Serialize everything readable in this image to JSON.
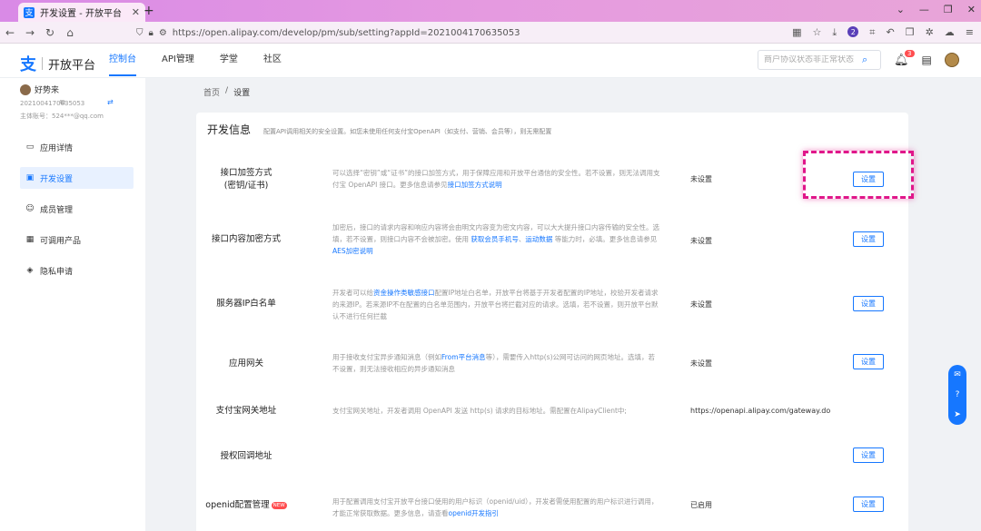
{
  "browser": {
    "tab_title": "开发设置 - 开放平台",
    "tab_favicon": "支",
    "url": "https://open.alipay.com/develop/pm/sub/setting?appId=2021004170635053",
    "ext_badge": "2"
  },
  "header": {
    "logo_mark": "支",
    "logo_text": "开放平台",
    "nav": [
      "控制台",
      "API管理",
      "学堂",
      "社区"
    ],
    "search_placeholder": "商户协议状态非正常状态",
    "bell_count": "3"
  },
  "user": {
    "name": "好势来",
    "app_id": "2021004170635053",
    "account": "主体账号：524***@qq.com"
  },
  "sidebar": {
    "items": [
      {
        "label": "应用详情",
        "icon": "doc-icon"
      },
      {
        "label": "开发设置",
        "icon": "code-icon"
      },
      {
        "label": "成员管理",
        "icon": "users-icon"
      },
      {
        "label": "可调用产品",
        "icon": "product-icon"
      },
      {
        "label": "隐私申请",
        "icon": "shield-icon"
      }
    ]
  },
  "breadcrumb": {
    "home": "首页",
    "sep": "/",
    "current": "设置"
  },
  "card": {
    "title": "开发信息",
    "desc": "配置API调用相关的安全设置。如您未使用任何支付宝OpenAPI（如支付、营销、会员等），则无需配置"
  },
  "rows": [
    {
      "label1": "接口加签方式",
      "label2": "(密钥/证书)",
      "desc_a": "可以选择“密钥”或“证书”的接口加签方式，用于保障应用和开放平台通信的安全性。若不设置，则无法调用支付宝 OpenAPI 接口。更多信息请参见",
      "link_a": "接口加签方式说明",
      "status": "未设置",
      "button": "设置"
    },
    {
      "label1": "接口内容加密方式",
      "desc_a": "加密后，接口的请求内容和响应内容将会由明文内容变为密文内容，可以大大提升接口内容传输的安全性。选填，若不设置，则接口内容不会被加密。使用 ",
      "link_a": "获取会员手机号",
      "desc_b": "、",
      "link_b": "运动数据",
      "desc_c": " 等能力时，必填。更多信息请参见",
      "link_c": "AES加密说明",
      "status": "未设置",
      "button": "设置"
    },
    {
      "label1": "服务器IP白名单",
      "desc_a": "开发者可以给",
      "link_a": "资金操作类敏感接口",
      "desc_b": "配置IP地址白名单，开放平台将基于开发者配置的IP地址，校验开发者请求的来源IP。若来源IP不在配置的白名单范围内，开放平台将拦截对应的请求。选填，若不设置，则开放平台默认不进行任何拦截",
      "status": "未设置",
      "button": "设置"
    },
    {
      "label1": "应用网关",
      "desc_a": "用于接收支付宝异步通知消息（例如",
      "link_a": "From平台消息",
      "desc_b": "等），需要传入http(s)公网可访问的网页地址。选填，若不设置，则无法接收相应的异步通知消息",
      "status": "未设置",
      "button": "设置"
    },
    {
      "label1": "支付宝网关地址",
      "desc_a": "支付宝网关地址，开发者调用 OpenAPI 发送 http(s) 请求的目标地址。需配置在AlipayClient中;",
      "status": "https://openapi.alipay.com/gateway.do"
    },
    {
      "label1": "授权回调地址",
      "button": "设置"
    },
    {
      "label1": "openid配置管理",
      "badge": "NEW",
      "desc_a": "用于配置调用支付宝开放平台接口使用的用户标识（openid/uid），开发者需使用配置的用户标识进行调用，才能正常获取数据。更多信息，请查看",
      "link_a": "openid开发指引",
      "status": "已启用",
      "button": "设置"
    }
  ]
}
